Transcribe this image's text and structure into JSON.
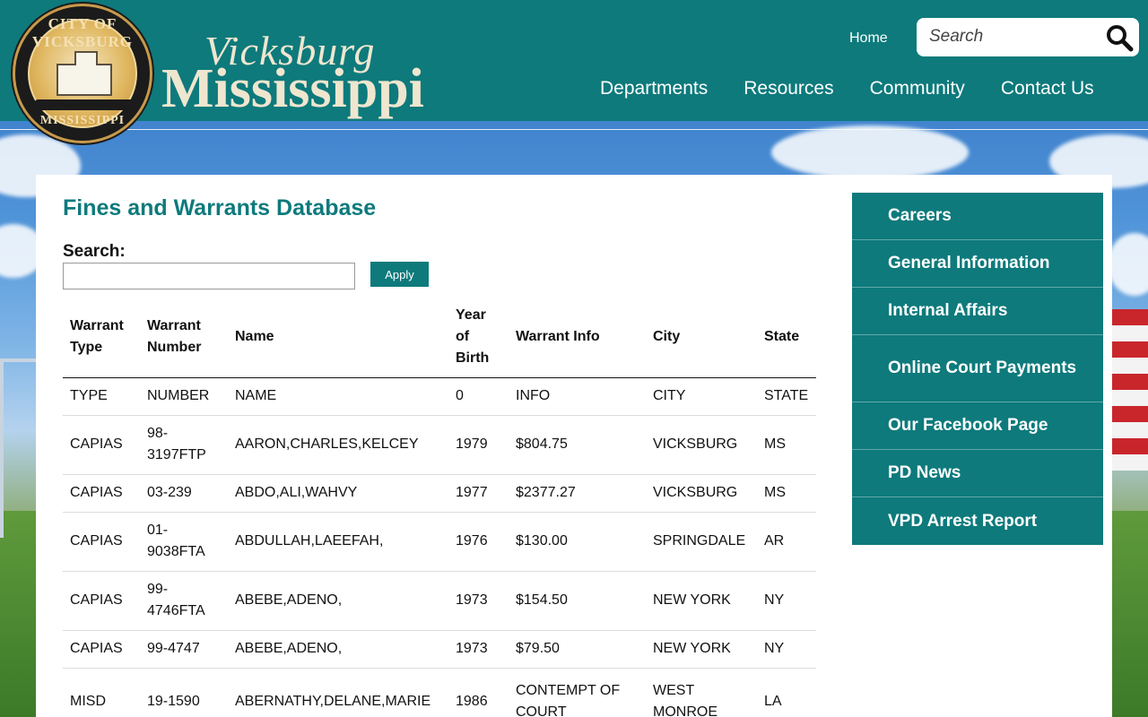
{
  "header": {
    "seal_text_top": "CITY OF VICKSBURG",
    "seal_text_bottom": "MISSISSIPPI",
    "brand_script": "Vicksburg",
    "brand_state": "Mississippi",
    "home_label": "Home",
    "search_placeholder": "Search",
    "nav": [
      "Departments",
      "Resources",
      "Community",
      "Contact Us"
    ]
  },
  "page": {
    "title": "Fines and Warrants Database",
    "search_label": "Search:",
    "apply_label": "Apply"
  },
  "table": {
    "headers": [
      "Warrant Type",
      "Warrant Number",
      "Name",
      "Year of Birth",
      "Warrant Info",
      "City",
      "State"
    ],
    "rows": [
      [
        "TYPE",
        "NUMBER",
        "NAME",
        "0",
        "INFO",
        "CITY",
        "STATE"
      ],
      [
        "CAPIAS",
        "98-3197FTP",
        "AARON,CHARLES,KELCEY",
        "1979",
        "$804.75",
        "VICKSBURG",
        "MS"
      ],
      [
        "CAPIAS",
        "03-239",
        "ABDO,ALI,WAHVY",
        "1977",
        "$2377.27",
        "VICKSBURG",
        "MS"
      ],
      [
        "CAPIAS",
        "01-9038FTA",
        "ABDULLAH,LAEEFAH,",
        "1976",
        "$130.00",
        "SPRINGDALE",
        "AR"
      ],
      [
        "CAPIAS",
        "99-4746FTA",
        "ABEBE,ADENO,",
        "1973",
        "$154.50",
        "NEW YORK",
        "NY"
      ],
      [
        "CAPIAS",
        "99-4747",
        "ABEBE,ADENO,",
        "1973",
        "$79.50",
        "NEW YORK",
        "NY"
      ],
      [
        "MISD",
        "19-1590",
        "ABERNATHY,DELANE,MARIE",
        "1986",
        "CONTEMPT OF COURT",
        "WEST MONROE",
        "LA"
      ]
    ]
  },
  "sidebar": {
    "items": [
      "Careers",
      "General Information",
      "Internal Affairs",
      "Online Court Payments",
      "Our Facebook Page",
      "PD News",
      "VPD Arrest Report"
    ]
  },
  "colors": {
    "teal": "#0e7a7c",
    "cream": "#efe6cf"
  }
}
